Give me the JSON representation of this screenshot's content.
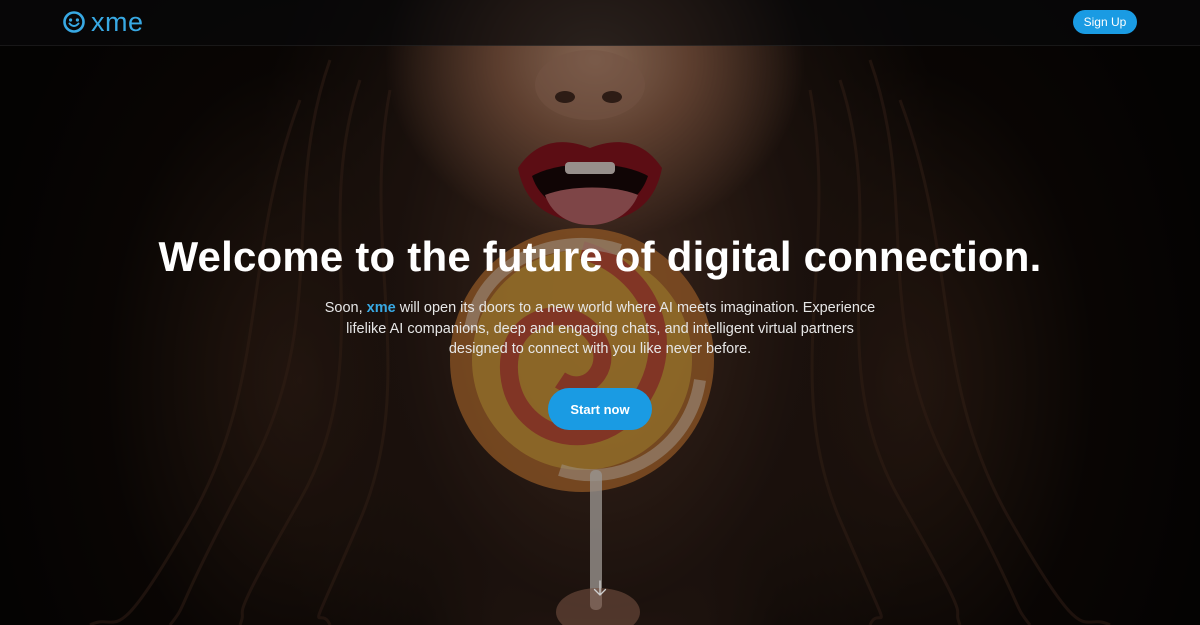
{
  "brand": {
    "name": "xme",
    "color": "#38a9e4",
    "logo_icon": "smiley-face-icon"
  },
  "nav": {
    "signup_label": "Sign Up"
  },
  "hero": {
    "headline": "Welcome to the future of digital connection.",
    "subtext_before": "Soon, ",
    "subtext_brand": "xme",
    "subtext_after": " will open its doors to a new world where AI meets imagination. Experience lifelike AI companions, deep and engaging chats, and intelligent virtual partners designed to connect with you like never before.",
    "cta_label": "Start now",
    "scroll_icon": "arrow-down-icon",
    "accent": "#1a9be3"
  }
}
